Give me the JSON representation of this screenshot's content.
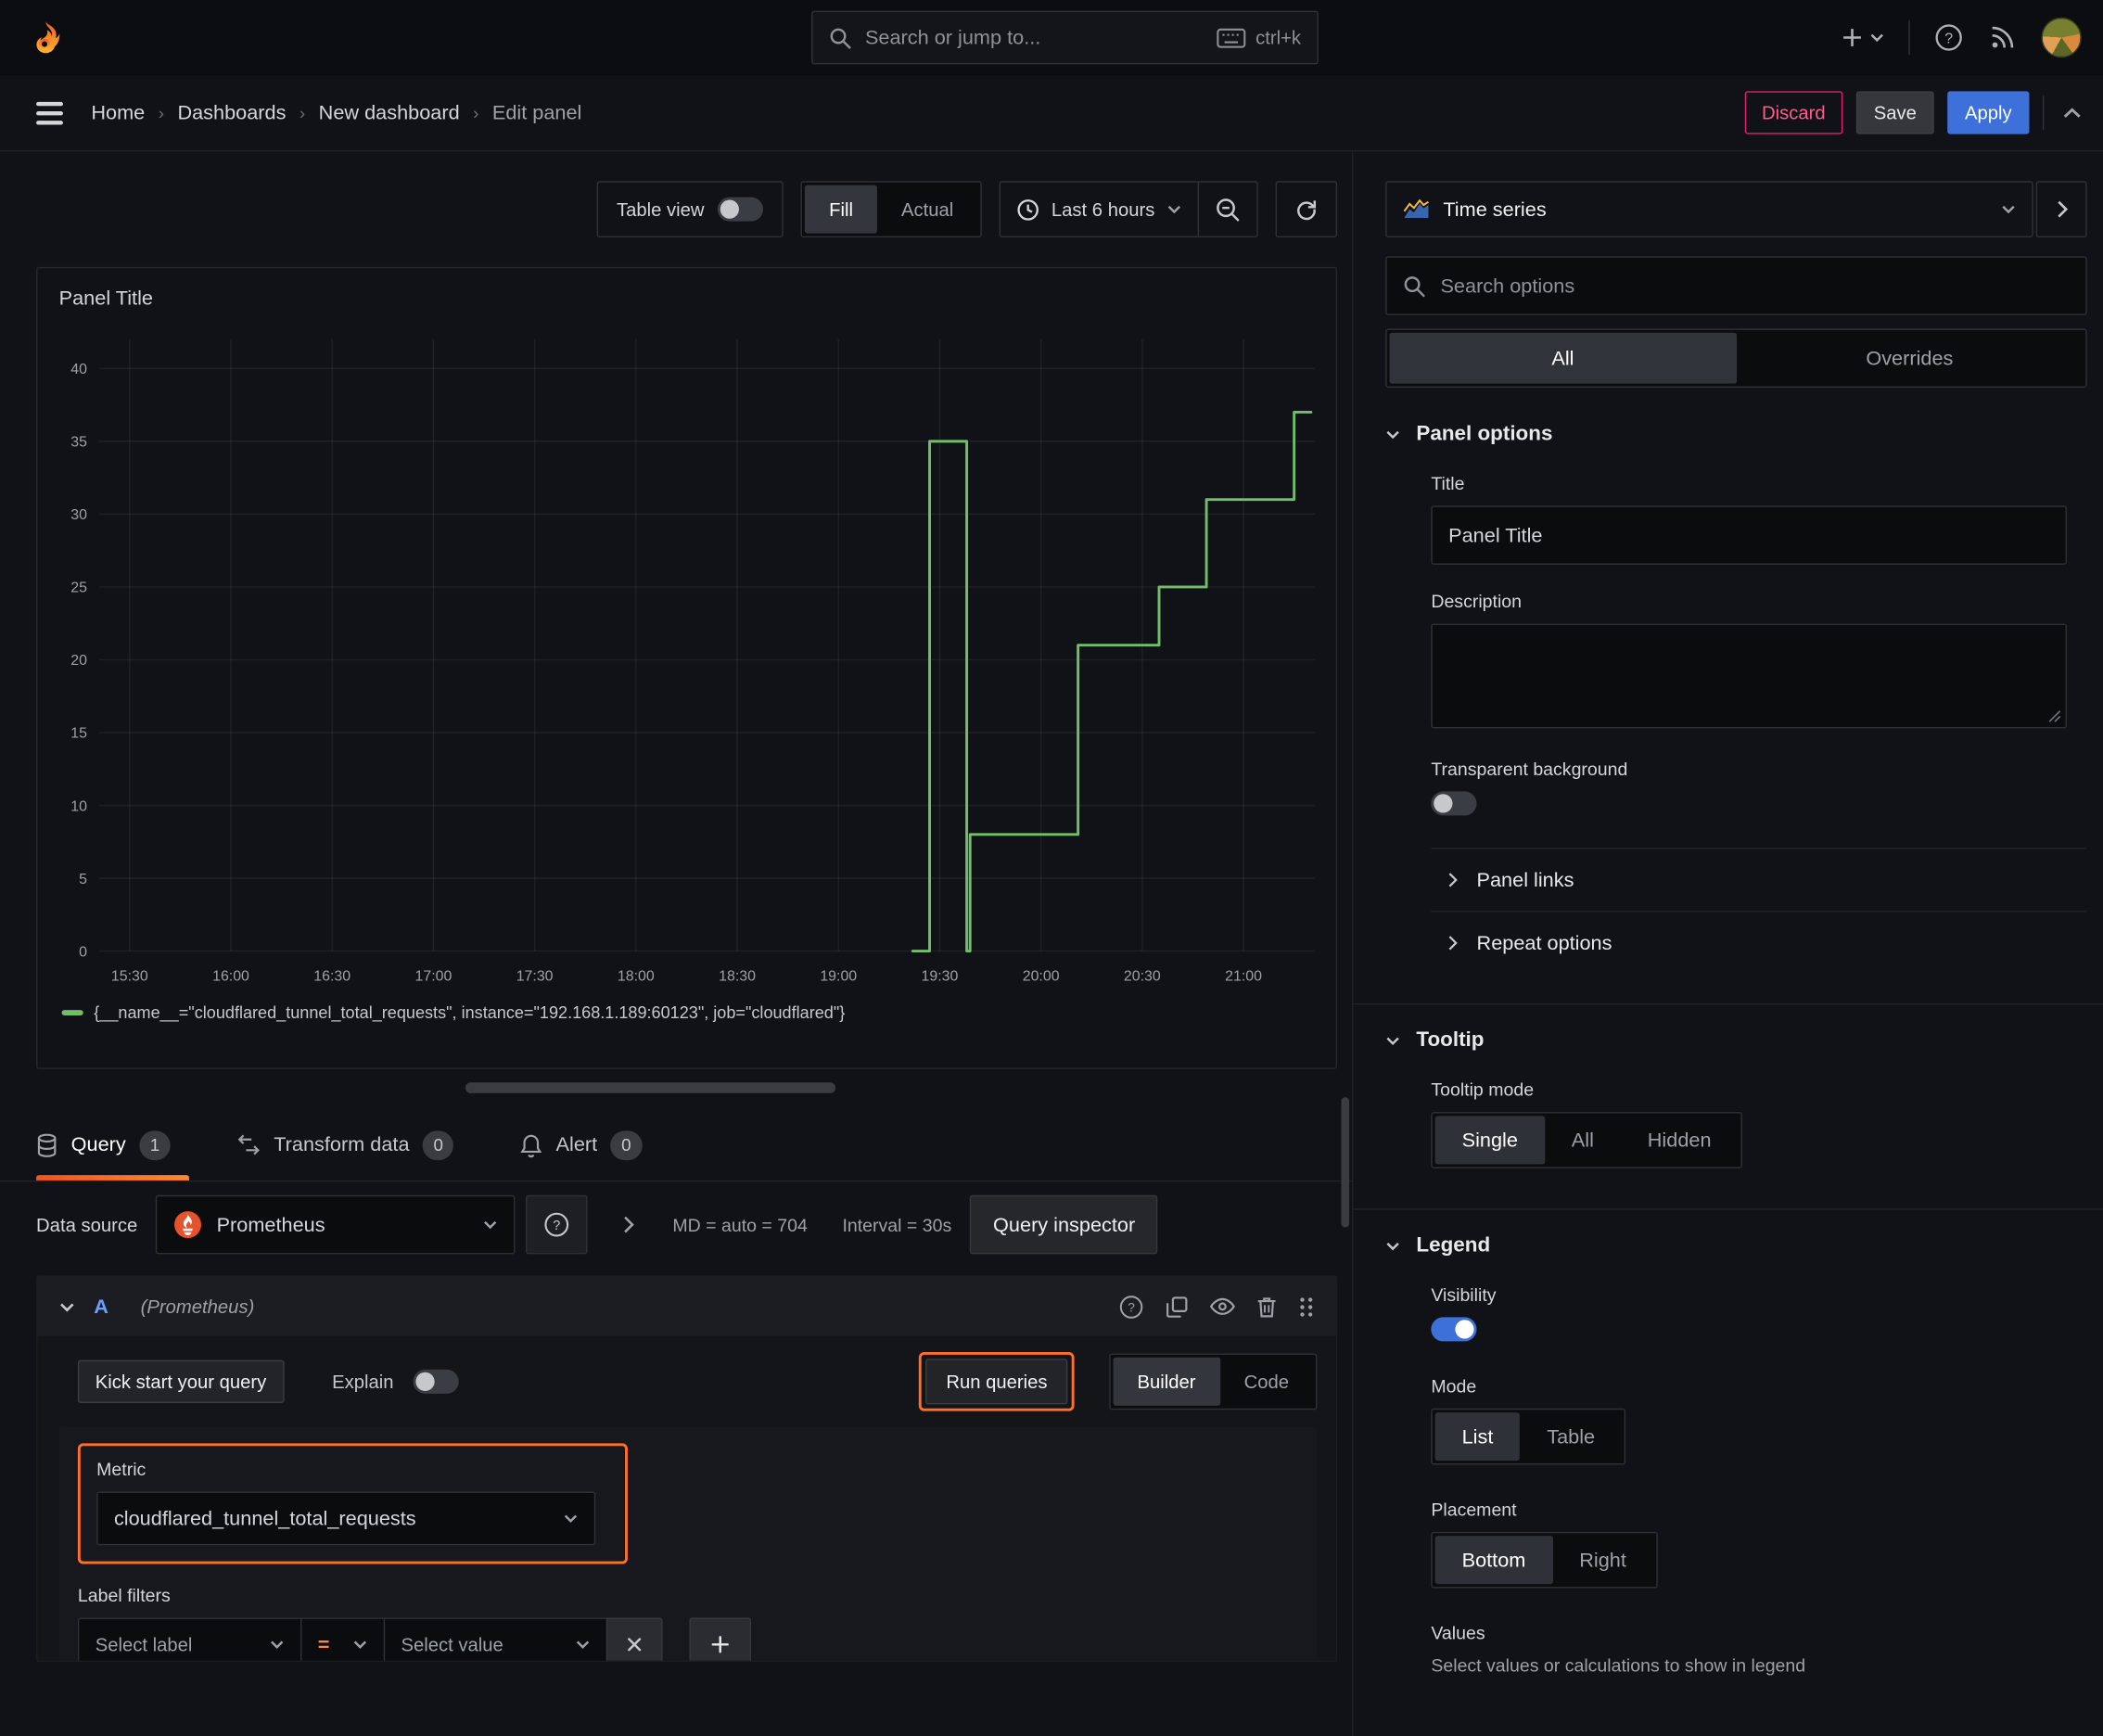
{
  "topbar": {
    "search_placeholder": "Search or jump to...",
    "shortcut": "ctrl+k"
  },
  "breadcrumb": {
    "items": [
      "Home",
      "Dashboards",
      "New dashboard",
      "Edit panel"
    ]
  },
  "actions": {
    "discard": "Discard",
    "save": "Save",
    "apply": "Apply"
  },
  "viz_toolbar": {
    "table_view": "Table view",
    "fill": "Fill",
    "actual": "Actual",
    "time_range": "Last 6 hours"
  },
  "panel": {
    "title": "Panel Title"
  },
  "chart_data": {
    "type": "line",
    "line_style": "step",
    "title": "Panel Title",
    "xlabel": "",
    "ylabel": "",
    "x_range_minutes": [
      921,
      1281
    ],
    "x_ticks": [
      "15:30",
      "16:00",
      "16:30",
      "17:00",
      "17:30",
      "18:00",
      "18:30",
      "19:00",
      "19:30",
      "20:00",
      "20:30",
      "21:00"
    ],
    "y_ticks": [
      0,
      5,
      10,
      15,
      20,
      25,
      30,
      35,
      40
    ],
    "ylim": [
      0,
      42
    ],
    "grid": true,
    "legend_position": "bottom",
    "series": [
      {
        "name": "{__name__=\"cloudflared_tunnel_total_requests\", instance=\"192.168.1.189:60123\", job=\"cloudflared\"}",
        "color": "#73bf69",
        "points": [
          [
            "19:22",
            0
          ],
          [
            "19:27",
            0
          ],
          [
            "19:27",
            35
          ],
          [
            "19:38",
            35
          ],
          [
            "19:38",
            0
          ],
          [
            "19:39",
            0
          ],
          [
            "19:39",
            8
          ],
          [
            "20:11",
            8
          ],
          [
            "20:11",
            21
          ],
          [
            "20:35",
            21
          ],
          [
            "20:35",
            25
          ],
          [
            "20:49",
            25
          ],
          [
            "20:49",
            31
          ],
          [
            "21:15",
            31
          ],
          [
            "21:15",
            37
          ],
          [
            "21:20",
            37
          ]
        ]
      }
    ],
    "legend": [
      {
        "label": "{__name__=\"cloudflared_tunnel_total_requests\", instance=\"192.168.1.189:60123\", job=\"cloudflared\"}",
        "color": "#73bf69"
      }
    ]
  },
  "tabs": {
    "query": {
      "label": "Query",
      "count": "1"
    },
    "transform": {
      "label": "Transform data",
      "count": "0"
    },
    "alert": {
      "label": "Alert",
      "count": "0"
    }
  },
  "datasource": {
    "label": "Data source",
    "name": "Prometheus",
    "md": "MD = auto = 704",
    "interval": "Interval = 30s",
    "inspector": "Query inspector"
  },
  "query_editor": {
    "ref_id": "A",
    "ds_hint": "(Prometheus)",
    "kick_start": "Kick start your query",
    "explain": "Explain",
    "run_queries": "Run queries",
    "builder": "Builder",
    "code": "Code",
    "metric_label": "Metric",
    "metric_value": "cloudflared_tunnel_total_requests",
    "label_filters": "Label filters",
    "select_label": "Select label",
    "operator": "=",
    "select_value": "Select value"
  },
  "sidebar": {
    "viz_name": "Time series",
    "search_placeholder": "Search options",
    "tab_all": "All",
    "tab_overrides": "Overrides",
    "panel_options": {
      "heading": "Panel options",
      "title_label": "Title",
      "title_value": "Panel Title",
      "description_label": "Description",
      "transparent_label": "Transparent background"
    },
    "links": "Panel links",
    "repeat": "Repeat options",
    "tooltip": {
      "heading": "Tooltip",
      "mode_label": "Tooltip mode",
      "options": [
        "Single",
        "All",
        "Hidden"
      ]
    },
    "legend": {
      "heading": "Legend",
      "visibility_label": "Visibility",
      "mode_label": "Mode",
      "mode_options": [
        "List",
        "Table"
      ],
      "placement_label": "Placement",
      "placement_options": [
        "Bottom",
        "Right"
      ],
      "values_label": "Values",
      "values_hint": "Select values or calculations to show in legend"
    }
  }
}
